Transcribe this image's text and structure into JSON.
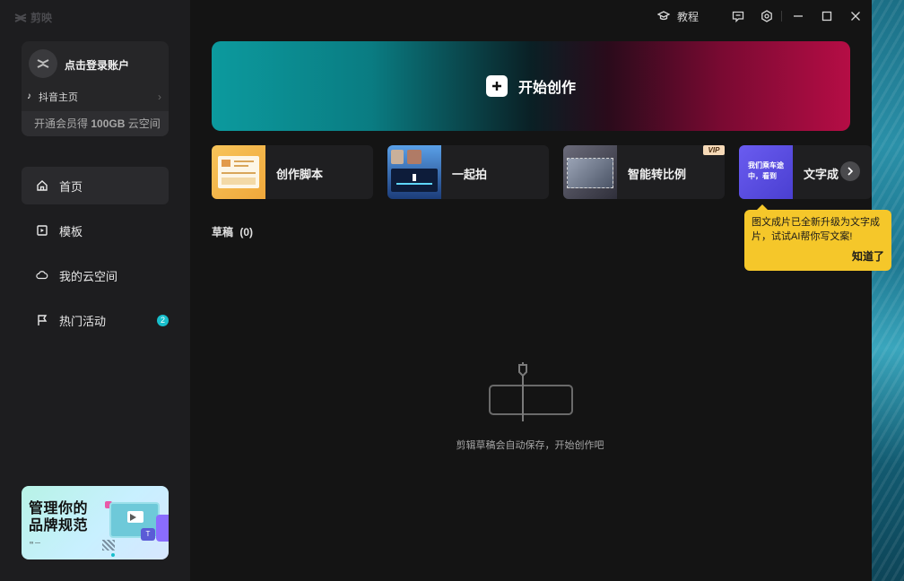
{
  "app": {
    "name": "剪映"
  },
  "account": {
    "login_label": "点击登录账户",
    "douyin_label": "抖音主页",
    "vip_text_prefix": "开通会员得",
    "vip_text_bold": "100GB",
    "vip_text_suffix": "云空间"
  },
  "nav": {
    "items": [
      {
        "label": "首页",
        "icon": "home-icon",
        "active": true
      },
      {
        "label": "模板",
        "icon": "template-icon",
        "active": false
      },
      {
        "label": "我的云空间",
        "icon": "cloud-icon",
        "active": false
      },
      {
        "label": "热门活动",
        "icon": "flag-icon",
        "active": false,
        "badge": "2"
      }
    ]
  },
  "promo": {
    "title_line1": "管理你的",
    "title_line2": "品牌规范",
    "tag": "T"
  },
  "titlebar": {
    "tutorial_label": "教程"
  },
  "main": {
    "create_label": "开始创作",
    "features": [
      {
        "label": "创作脚本"
      },
      {
        "label": "一起拍"
      },
      {
        "label": "智能转比例",
        "vip": "VIP"
      },
      {
        "label": "文字成",
        "thumb_text_line1": "我们乘车途",
        "thumb_text_line2": "中，看到"
      }
    ],
    "drafts_label": "草稿",
    "drafts_count": "(0)",
    "empty_text": "剪辑草稿会自动保存，开始创作吧"
  },
  "tooltip": {
    "line1": "图文成片已全新升级为文字成",
    "line2": "片，试试AI帮你写文案!",
    "ok_label": "知道了"
  },
  "colors": {
    "accent": "#18bfcc",
    "tooltip": "#f5c72a",
    "vip": "#f6d9b7"
  }
}
